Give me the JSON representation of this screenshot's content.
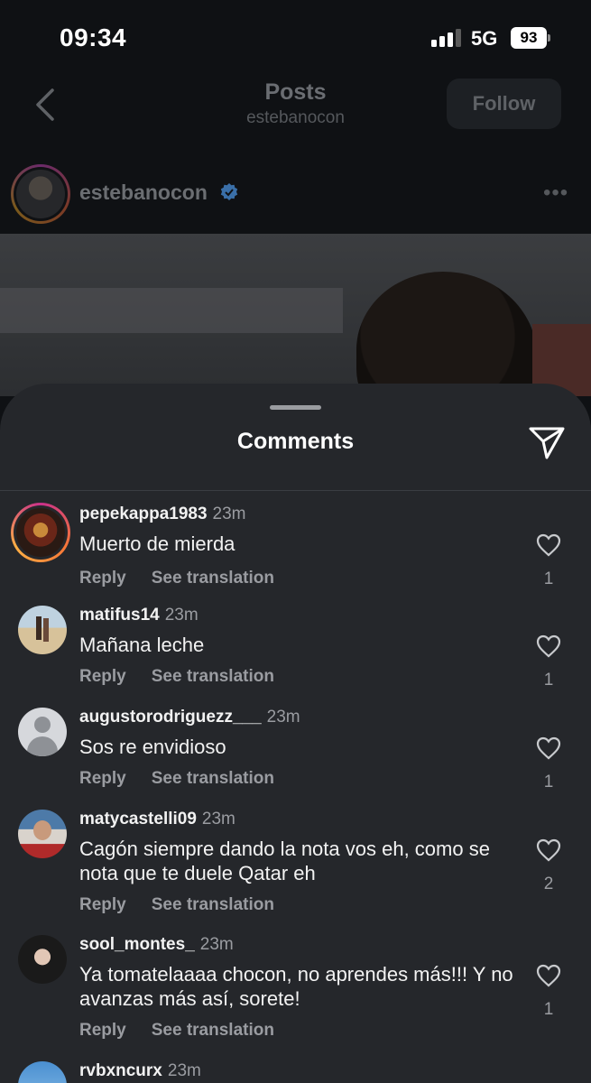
{
  "status_bar": {
    "time": "09:34",
    "network": "5G",
    "battery": "93"
  },
  "nav": {
    "title": "Posts",
    "subtitle": "estebanocon",
    "follow_label": "Follow"
  },
  "post": {
    "username": "estebanocon",
    "more": "•••"
  },
  "sheet": {
    "title": "Comments"
  },
  "comments": [
    {
      "username": "pepekappa1983",
      "time": "23m",
      "text": "Muerto de mierda",
      "reply": "Reply",
      "translate": "See translation",
      "likes": "1"
    },
    {
      "username": "matifus14",
      "time": "23m",
      "text": "Mañana leche",
      "reply": "Reply",
      "translate": "See translation",
      "likes": "1"
    },
    {
      "username": "augustorodriguezz___",
      "time": "23m",
      "text": "Sos re envidioso",
      "reply": "Reply",
      "translate": "See translation",
      "likes": "1"
    },
    {
      "username": "matycastelli09",
      "time": "23m",
      "text": "Cagón siempre dando la nota vos eh, como se nota que te duele Qatar eh",
      "reply": "Reply",
      "translate": "See translation",
      "likes": "2"
    },
    {
      "username": "sool_montes_",
      "time": "23m",
      "text": "Ya tomatelaaaa chocon, no aprendes más!!! Y no avanzas más así, sorete!",
      "reply": "Reply",
      "translate": "See translation",
      "likes": "1"
    },
    {
      "username": "rvbxncurx",
      "time": "23m"
    }
  ],
  "colors": {
    "sheet_bg": "#25272b",
    "screen_bg": "#0f1114",
    "verified": "#3a6fa8",
    "muted_text": "#9a9ca1"
  },
  "icons": [
    "back-chevron-icon",
    "verified-badge-icon",
    "more-icon",
    "share-icon",
    "heart-icon"
  ]
}
